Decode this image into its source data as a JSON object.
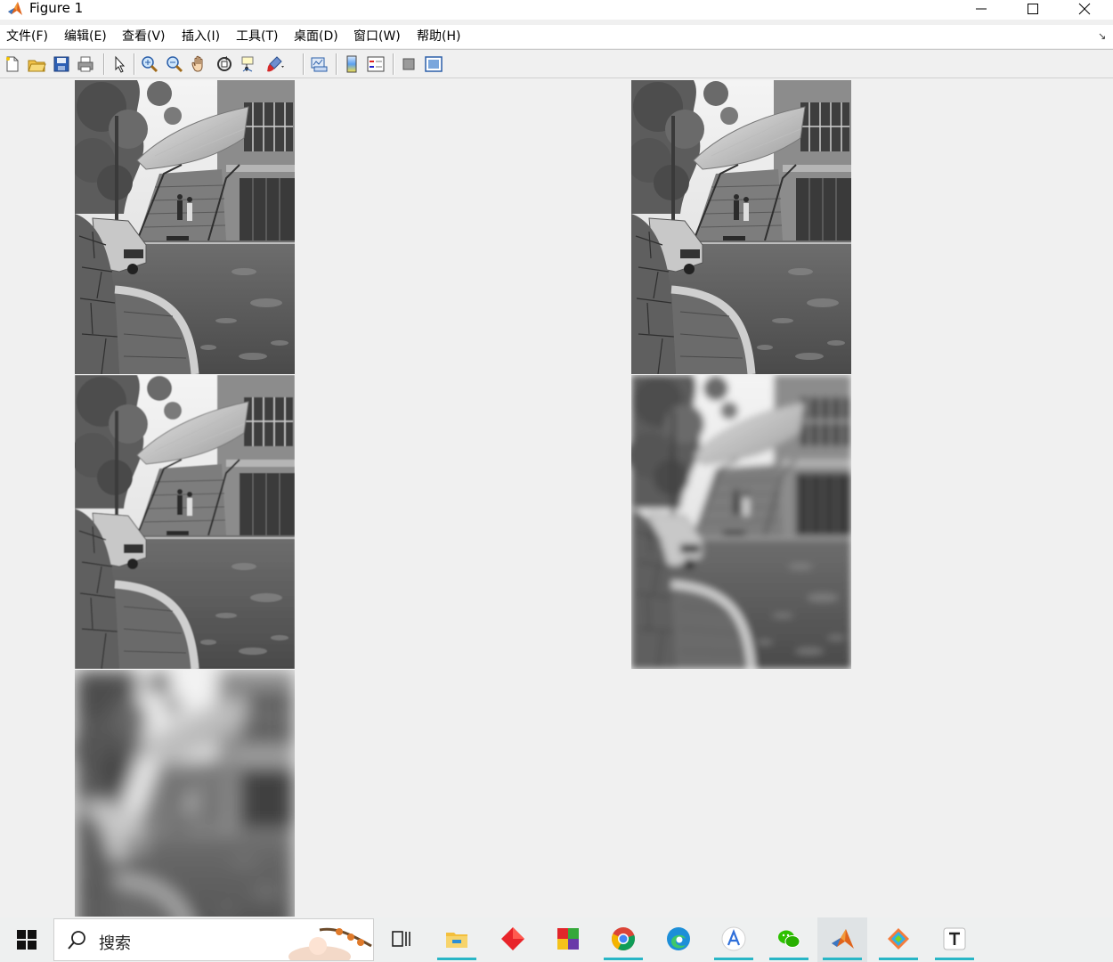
{
  "window": {
    "title": "Figure 1"
  },
  "menu": [
    {
      "label": "文件(F)"
    },
    {
      "label": "编辑(E)"
    },
    {
      "label": "查看(V)"
    },
    {
      "label": "插入(I)"
    },
    {
      "label": "工具(T)"
    },
    {
      "label": "桌面(D)"
    },
    {
      "label": "窗口(W)"
    },
    {
      "label": "帮助(H)"
    }
  ],
  "toolbar": {
    "buttons": [
      "new-figure-icon",
      "open-file-icon",
      "save-icon",
      "print-icon",
      "edit-plot-arrow-icon",
      "zoom-in-icon",
      "zoom-out-icon",
      "pan-hand-icon",
      "rotate-3d-icon",
      "data-cursor-icon",
      "brush-icon",
      "link-plot-icon",
      "insert-colorbar-icon",
      "insert-legend-icon",
      "hide-plot-tools-icon",
      "show-plot-tools-icon"
    ]
  },
  "figure": {
    "subplots": [
      {
        "blur": 0
      },
      {
        "blur": 0
      },
      {
        "blur": 0.6
      },
      {
        "blur": 4
      },
      {
        "blur": 10
      }
    ]
  },
  "taskbar": {
    "search_placeholder": "搜索",
    "apps": [
      {
        "name": "task-view-icon",
        "running": false
      },
      {
        "name": "file-explorer-icon",
        "running": true
      },
      {
        "name": "red-diamond-app-icon",
        "running": false
      },
      {
        "name": "colorful-squares-app-icon",
        "running": false
      },
      {
        "name": "chrome-icon",
        "running": true
      },
      {
        "name": "edge-icon",
        "running": false
      },
      {
        "name": "translate-app-icon",
        "running": true
      },
      {
        "name": "wechat-icon",
        "running": true
      },
      {
        "name": "matlab-icon",
        "running": true
      },
      {
        "name": "git-app-icon",
        "running": true
      },
      {
        "name": "typora-icon",
        "running": true
      }
    ]
  }
}
